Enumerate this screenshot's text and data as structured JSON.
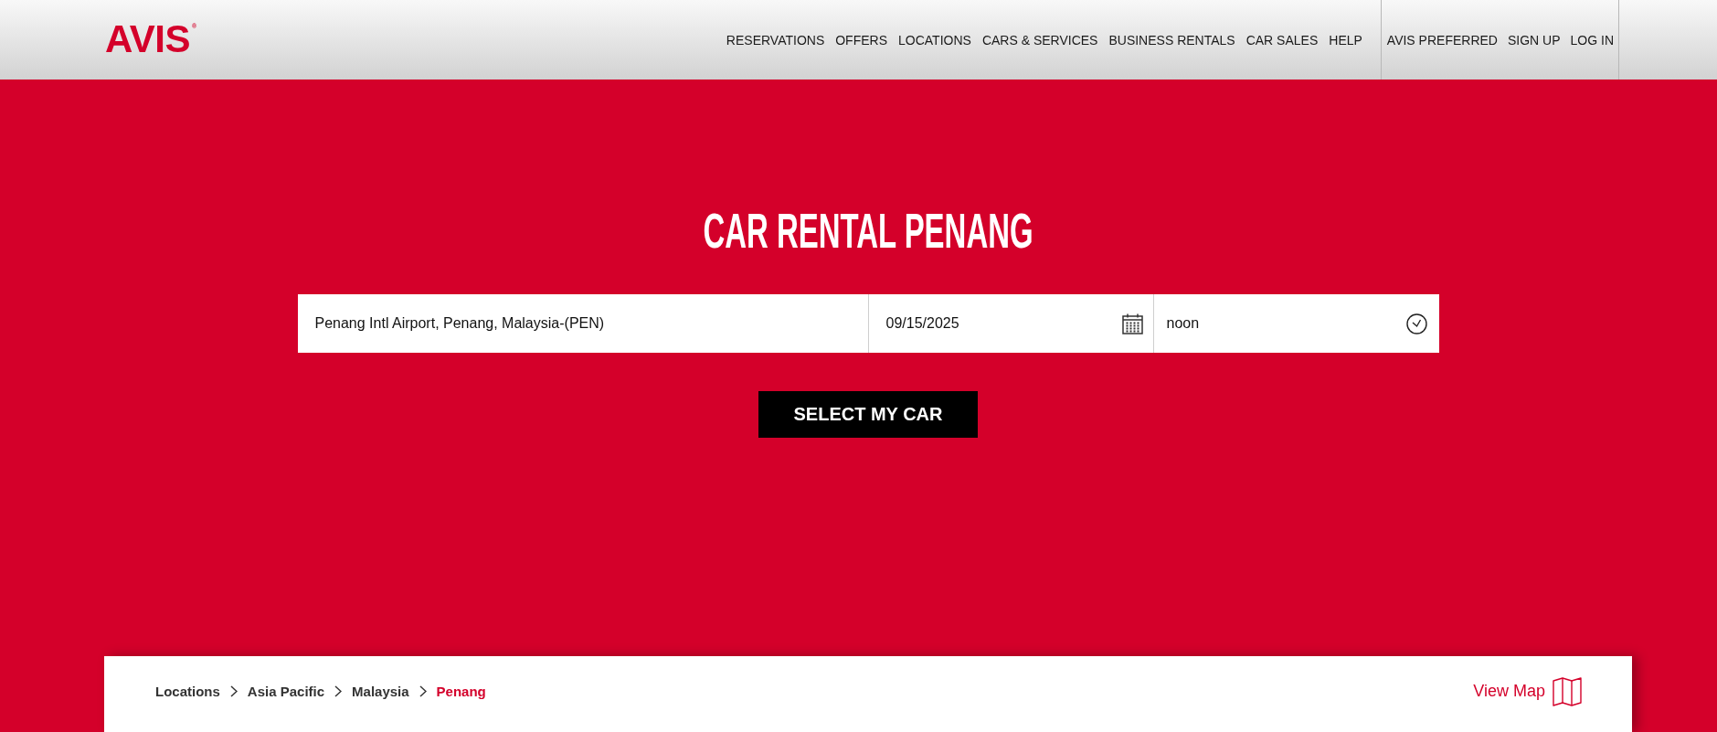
{
  "header": {
    "logo": "AVIS$^{®}$",
    "nav": [
      "RESERVATIONS",
      "OFFERS",
      "LOCATIONS",
      "CARS & SERVICES",
      "BUSINESS RENTALS",
      "CAR SALES",
      "HELP"
    ],
    "account_nav": [
      "AVIS PREFERRED",
      "SIGN UP",
      "LOG IN"
    ]
  },
  "hero": {
    "title": "CAR RENTAL PENANG",
    "search": {
      "location": {
        "value": "Penang Intl Airport, Penang, Malaysia-(PEN)"
      },
      "date": {
        "value": "09/15/2025"
      },
      "time": {
        "value": "noon"
      }
    },
    "submit": "SELECT MY CAR"
  },
  "location_card": {
    "breadcrumb": [
      {
        "label": "Locations",
        "current": false
      },
      {
        "label": "Asia Pacific",
        "current": false
      },
      {
        "label": "Malaysia",
        "current": false
      },
      {
        "label": "Penang",
        "current": true
      }
    ],
    "view_map": "View Map"
  }
}
